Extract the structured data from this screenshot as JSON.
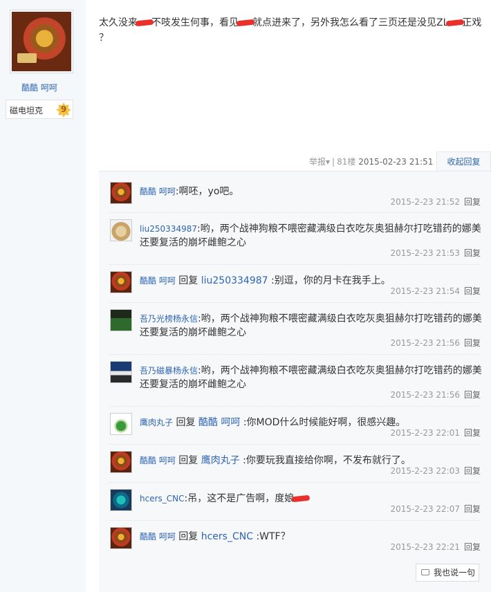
{
  "post": {
    "author": "酷酷 呵呵",
    "level_name": "磁电坦克",
    "level_number": "9",
    "content_parts": [
      "太久没来",
      "不吱发生何事，看见",
      "就点进来了，另外我怎么看了三页还是没见ZL",
      "正戏",
      "？"
    ],
    "meta": {
      "report": "举报",
      "report_caret": "▾",
      "separator": "|",
      "floor": "81楼",
      "datetime": "2015-02-23 21:51",
      "collapse": "收起回复"
    }
  },
  "replies": [
    {
      "user": "酷酷 呵呵",
      "colon": ":",
      "text": "啊呸，yo吧。",
      "time": "2015-2-23 21:52",
      "reply_label": "回复"
    },
    {
      "user": "liu250334987",
      "colon": ":",
      "text": "哟，两个战神狗粮不喂密藏满级白衣吃灰奥狙赫尔打吃错药的娜美还要复活的崩坏雌鲍之心",
      "time": "2015-2-23 21:53",
      "reply_label": "回复"
    },
    {
      "user": "酷酷 呵呵",
      "colon": ":",
      "prefix": " 回复 ",
      "target": "liu250334987",
      "text": " :别逗，你的月卡在我手上。",
      "time": "2015-2-23 21:54",
      "reply_label": "回复"
    },
    {
      "user": "吾乃光榜杨永信",
      "colon": ":",
      "text": "哟，两个战神狗粮不喂密藏满级白衣吃灰奥狙赫尔打吃错药的娜美还要复活的崩坏雌鲍之心",
      "time": "2015-2-23 21:56",
      "reply_label": "回复"
    },
    {
      "user": "吾乃磁暴杨永信",
      "colon": ":",
      "text": "哟，两个战神狗粮不喂密藏满级白衣吃灰奥狙赫尔打吃错药的娜美还要复活的崩坏雌鲍之心",
      "time": "2015-2-23 21:56",
      "reply_label": "回复"
    },
    {
      "user": "鹰肉丸子",
      "colon": ":",
      "prefix": " 回复 ",
      "target": "酷酷 呵呵",
      "text": " :你MOD什么时候能好啊，很感兴趣。",
      "time": "2015-2-23 22:01",
      "reply_label": "回复"
    },
    {
      "user": "酷酷 呵呵",
      "colon": ":",
      "prefix": " 回复 ",
      "target": "鹰肉丸子",
      "text": " :你要玩我直接给你啊，不发布就行了。",
      "time": "2015-2-23 22:03",
      "reply_label": "回复"
    },
    {
      "user": "hcers_CNC",
      "colon": ":",
      "text": "吊，这不是广告啊，度娘",
      "time": "2015-2-23 22:07",
      "reply_label": "回复"
    },
    {
      "user": "酷酷 呵呵",
      "colon": ":",
      "prefix": " 回复 ",
      "target": "hcers_CNC",
      "text": " :WTF？",
      "time": "2015-2-23 22:21",
      "reply_label": "回复"
    }
  ],
  "say_button": "我也说一句"
}
